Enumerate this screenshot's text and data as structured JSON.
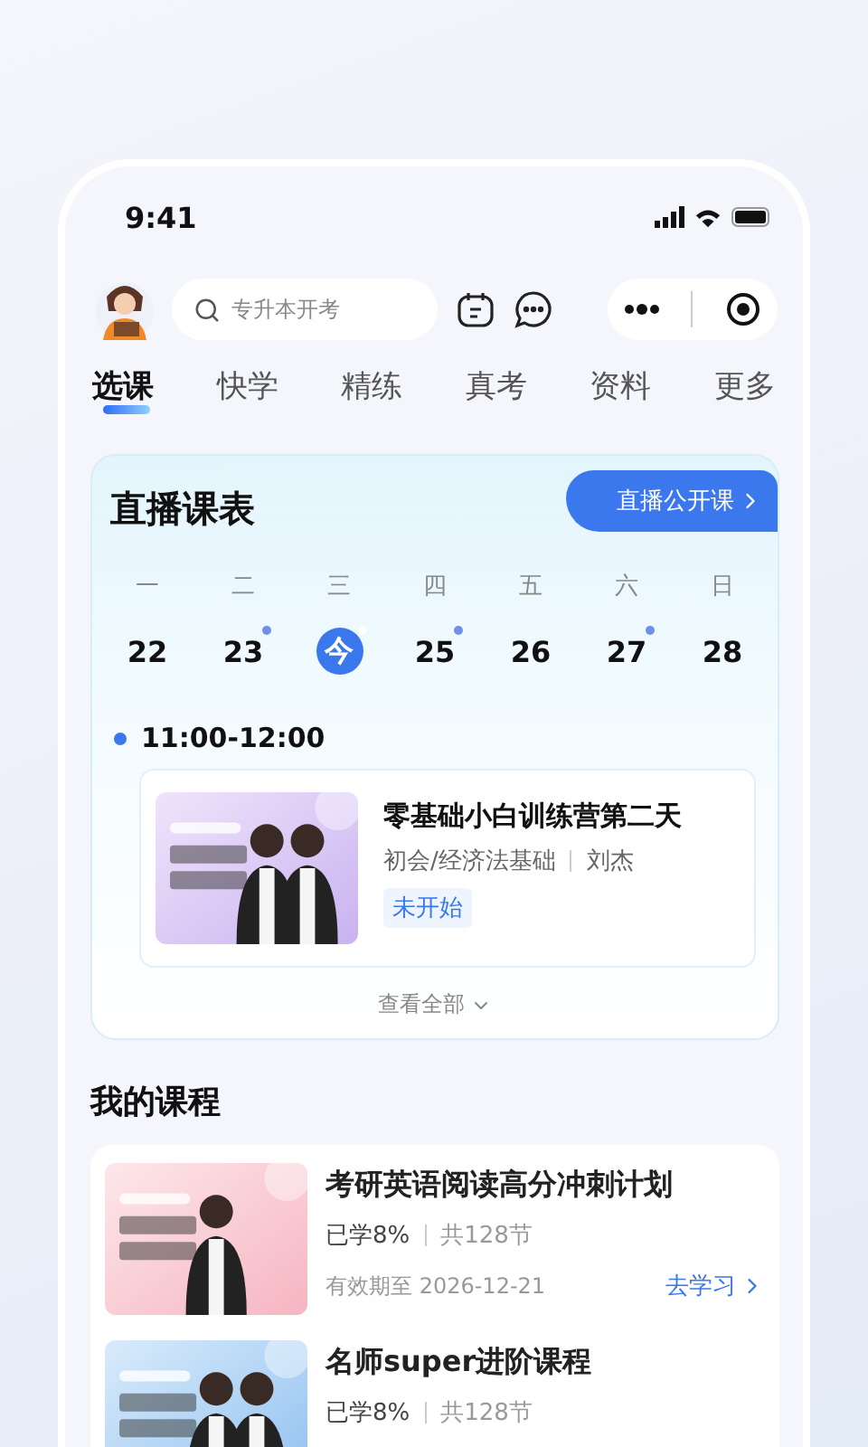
{
  "status_bar": {
    "time": "9:41"
  },
  "search": {
    "placeholder": "专升本开考"
  },
  "tabs": [
    {
      "label": "选课",
      "selected": true
    },
    {
      "label": "快学",
      "selected": false
    },
    {
      "label": "精练",
      "selected": false
    },
    {
      "label": "真考",
      "selected": false
    },
    {
      "label": "资料",
      "selected": false
    },
    {
      "label": "更多",
      "selected": false
    }
  ],
  "live_schedule": {
    "title": "直播课表",
    "public_link": "直播公开课",
    "days": [
      {
        "weekday": "一",
        "date": "22",
        "selected": false,
        "has_class": false
      },
      {
        "weekday": "二",
        "date": "23",
        "selected": false,
        "has_class": true
      },
      {
        "weekday": "三",
        "date": "今",
        "selected": true,
        "has_class": true
      },
      {
        "weekday": "四",
        "date": "25",
        "selected": false,
        "has_class": true
      },
      {
        "weekday": "五",
        "date": "26",
        "selected": false,
        "has_class": false
      },
      {
        "weekday": "六",
        "date": "27",
        "selected": false,
        "has_class": true
      },
      {
        "weekday": "日",
        "date": "28",
        "selected": false,
        "has_class": false
      }
    ],
    "sessions": [
      {
        "time": "11:00-12:00",
        "title": "零基础小白训练营第二天",
        "subject": "初会/经济法基础",
        "teacher": "刘杰",
        "status": "未开始"
      }
    ],
    "view_all": "查看全部"
  },
  "my_courses": {
    "title": "我的课程",
    "courses": [
      {
        "title": "考研英语阅读高分冲刺计划",
        "progress": "已学8%",
        "lessons": "共128节",
        "expiry": "有效期至 2026-12-21",
        "action": "去学习"
      },
      {
        "title": "名师super进阶课程",
        "progress": "已学8%",
        "lessons": "共128节"
      }
    ]
  }
}
